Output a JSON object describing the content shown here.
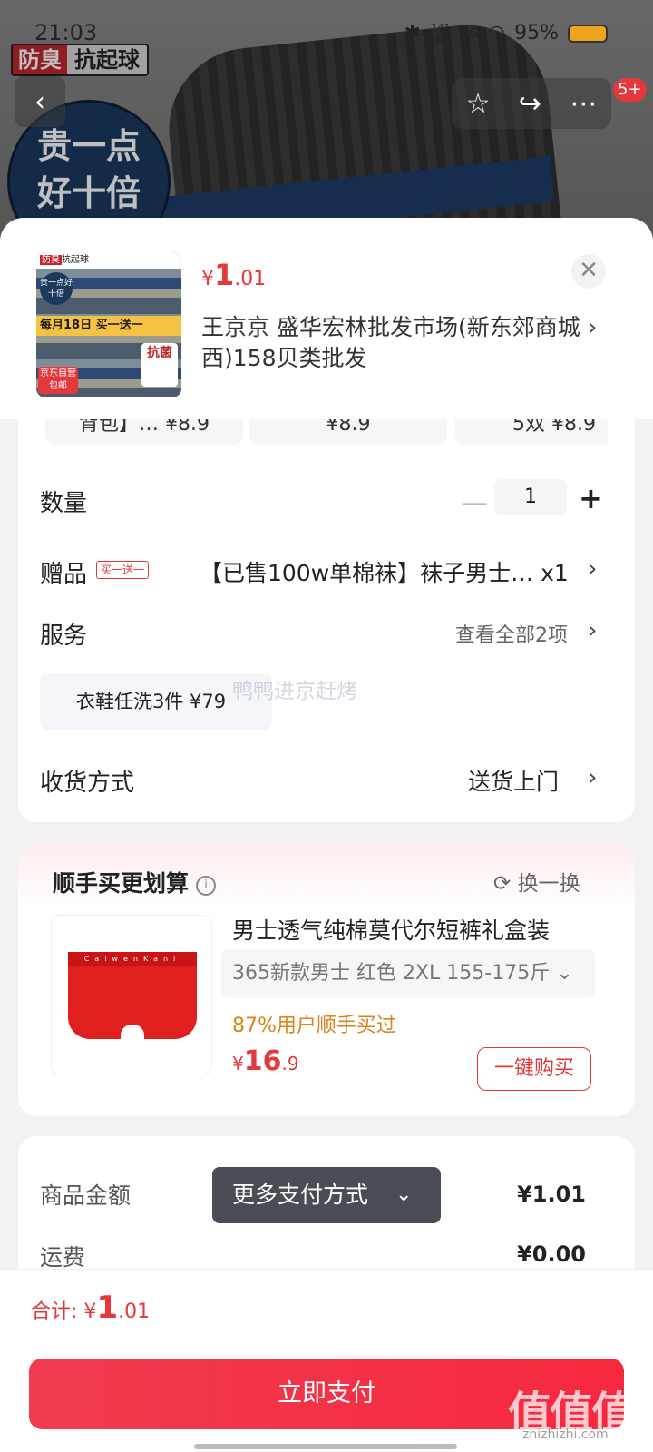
{
  "status_bar": {
    "time": "21:03",
    "net_speed": "141",
    "net_unit": "KB/s",
    "signal": "5G",
    "battery": "95%"
  },
  "bg_product": {
    "badge_red": "防臭",
    "badge_black": "抗起球",
    "circle_line1": "贵一点",
    "circle_line2": "好十倍",
    "cart_count": "5+"
  },
  "sheet": {
    "price": {
      "symbol": "¥",
      "int": "1",
      "dec": ".01"
    },
    "address": "王京京  盛华宏林批发市场(新东郊商城西)158贝类批发",
    "thumb": {
      "brand_red": "防臭",
      "brand_black": "抗起球",
      "circle": "贵一点好十倍",
      "ribbon": "每月18日 买一送一",
      "tag": "京东自营包邮",
      "side": "抗菌"
    },
    "specs": [
      {
        "label": "背包】…  ¥8.9"
      },
      {
        "label": "¥8.9"
      },
      {
        "label": "5双  ¥8.9"
      }
    ],
    "qty_label": "数量",
    "qty_value": "1",
    "gift_label": "赠品",
    "gift_tag": "买一送一",
    "gift_value": "【已售100w单棉袜】袜子男士… x1",
    "service_label": "服务",
    "service_value": "查看全部2项",
    "service_chip": "衣鞋任洗3件  ¥79",
    "delivery_label": "收货方式",
    "delivery_value": "送货上门"
  },
  "watermark": "鸭鸭进京赶烤",
  "recommend": {
    "title": "顺手买更划算",
    "swap": "换一换",
    "name": "男士透气纯棉莫代尔短裤礼盒装",
    "spec": "365新款男士 红色   2XL 155-175斤 ⌄",
    "stat": "87%用户顺手买过",
    "price": {
      "symbol": "¥",
      "int": "16",
      "dec": ".9"
    },
    "buy": "一键购买",
    "waist_text": "CaiwenKani"
  },
  "summary": {
    "goods_label": "商品金额",
    "goods_value": "¥1.01",
    "ship_label": "运费",
    "ship_value": "¥0.00"
  },
  "more_pay": "更多支付方式",
  "bottom": {
    "total_label": "合计: ¥",
    "total_int": "1",
    "total_dec": ".01",
    "pay": "立即支付"
  },
  "site_logo": "值值值",
  "site_url": "zhizhizhi.com"
}
